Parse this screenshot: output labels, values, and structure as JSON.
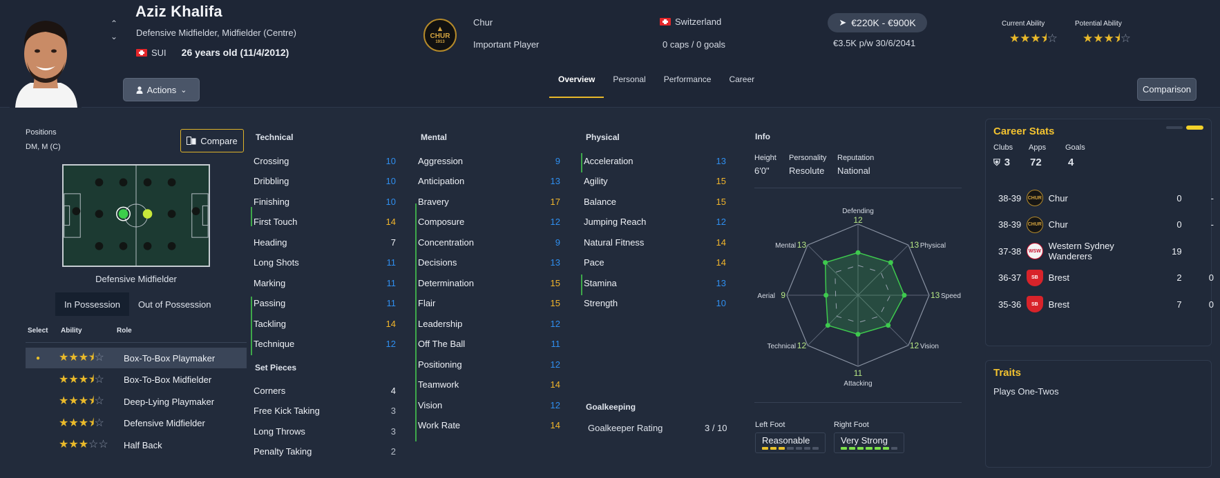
{
  "player": {
    "name": "Aziz Khalifa",
    "positions_full": "Defensive Midfielder, Midfielder (Centre)",
    "nationality_code": "SUI",
    "age_dob": "26 years old (11/4/2012)"
  },
  "header": {
    "actions_label": "Actions",
    "club": "Chur",
    "club_badge_text": "CHUR",
    "club_badge_year": "1913",
    "squad_status": "Important Player",
    "country": "Switzerland",
    "caps_goals": "0 caps / 0 goals",
    "value_range": "€220K - €900K",
    "wage_contract": "€3.5K p/w 30/6/2041",
    "current_ability_label": "Current Ability",
    "potential_ability_label": "Potential Ability",
    "current_ability_stars": 3.5,
    "potential_ability_stars": 3.5,
    "comparison_label": "Comparison"
  },
  "tabs": [
    "Overview",
    "Personal",
    "Performance",
    "Career"
  ],
  "active_tab": "Overview",
  "left": {
    "positions_label": "Positions",
    "positions_short": "DM, M (C)",
    "compare_label": "Compare",
    "pitch_caption": "Defensive Midfielder",
    "possession_tabs": [
      "In Possession",
      "Out of Possession"
    ],
    "role_headers": {
      "select": "Select",
      "ability": "Ability",
      "role": "Role"
    },
    "roles": [
      {
        "name": "Box-To-Box Playmaker",
        "stars": 3.5,
        "selected": true
      },
      {
        "name": "Box-To-Box Midfielder",
        "stars": 3.5,
        "selected": false
      },
      {
        "name": "Deep-Lying Playmaker",
        "stars": 3.5,
        "selected": false
      },
      {
        "name": "Defensive Midfielder",
        "stars": 3.5,
        "selected": false
      },
      {
        "name": "Half Back",
        "stars": 3,
        "selected": false
      }
    ]
  },
  "technical": {
    "title": "Technical",
    "attrs": [
      {
        "name": "Crossing",
        "value": "10",
        "color": "#2f8ff0"
      },
      {
        "name": "Dribbling",
        "value": "10",
        "color": "#2f8ff0"
      },
      {
        "name": "Finishing",
        "value": "10",
        "color": "#2f8ff0"
      },
      {
        "name": "First Touch",
        "value": "14",
        "color": "#f2b52b"
      },
      {
        "name": "Heading",
        "value": "7",
        "color": "#eef1f6"
      },
      {
        "name": "Long Shots",
        "value": "11",
        "color": "#2f8ff0"
      },
      {
        "name": "Marking",
        "value": "11",
        "color": "#2f8ff0"
      },
      {
        "name": "Passing",
        "value": "11",
        "color": "#2f8ff0"
      },
      {
        "name": "Tackling",
        "value": "14",
        "color": "#f2b52b"
      },
      {
        "name": "Technique",
        "value": "12",
        "color": "#2f8ff0"
      }
    ]
  },
  "set_pieces": {
    "title": "Set Pieces",
    "attrs": [
      {
        "name": "Corners",
        "value": "4",
        "color": "#eef1f6"
      },
      {
        "name": "Free Kick Taking",
        "value": "3",
        "color": "#b7bec9"
      },
      {
        "name": "Long Throws",
        "value": "3",
        "color": "#b7bec9"
      },
      {
        "name": "Penalty Taking",
        "value": "2",
        "color": "#b7bec9"
      }
    ]
  },
  "mental": {
    "title": "Mental",
    "attrs": [
      {
        "name": "Aggression",
        "value": "9",
        "color": "#2f8ff0"
      },
      {
        "name": "Anticipation",
        "value": "13",
        "color": "#2f8ff0"
      },
      {
        "name": "Bravery",
        "value": "17",
        "color": "#f2b52b"
      },
      {
        "name": "Composure",
        "value": "12",
        "color": "#2f8ff0"
      },
      {
        "name": "Concentration",
        "value": "9",
        "color": "#2f8ff0"
      },
      {
        "name": "Decisions",
        "value": "13",
        "color": "#2f8ff0"
      },
      {
        "name": "Determination",
        "value": "15",
        "color": "#f2b52b"
      },
      {
        "name": "Flair",
        "value": "15",
        "color": "#f2b52b"
      },
      {
        "name": "Leadership",
        "value": "12",
        "color": "#2f8ff0"
      },
      {
        "name": "Off The Ball",
        "value": "11",
        "color": "#2f8ff0"
      },
      {
        "name": "Positioning",
        "value": "12",
        "color": "#2f8ff0"
      },
      {
        "name": "Teamwork",
        "value": "14",
        "color": "#f2b52b"
      },
      {
        "name": "Vision",
        "value": "12",
        "color": "#2f8ff0"
      },
      {
        "name": "Work Rate",
        "value": "14",
        "color": "#f2b52b"
      }
    ]
  },
  "physical": {
    "title": "Physical",
    "attrs": [
      {
        "name": "Acceleration",
        "value": "13",
        "color": "#2f8ff0"
      },
      {
        "name": "Agility",
        "value": "15",
        "color": "#f2b52b"
      },
      {
        "name": "Balance",
        "value": "15",
        "color": "#f2b52b"
      },
      {
        "name": "Jumping Reach",
        "value": "12",
        "color": "#2f8ff0"
      },
      {
        "name": "Natural Fitness",
        "value": "14",
        "color": "#f2b52b"
      },
      {
        "name": "Pace",
        "value": "14",
        "color": "#f2b52b"
      },
      {
        "name": "Stamina",
        "value": "13",
        "color": "#2f8ff0"
      },
      {
        "name": "Strength",
        "value": "10",
        "color": "#2f8ff0"
      }
    ]
  },
  "goalkeeping": {
    "title": "Goalkeeping",
    "rating_label": "Goalkeeper Rating",
    "rating_value": "3 / 10"
  },
  "info": {
    "title": "Info",
    "height_label": "Height",
    "height": "6'0\"",
    "personality_label": "Personality",
    "personality": "Resolute",
    "reputation_label": "Reputation",
    "reputation": "National",
    "left_foot_label": "Left Foot",
    "left_foot": "Reasonable",
    "left_foot_level": 3,
    "right_foot_label": "Right Foot",
    "right_foot": "Very Strong",
    "right_foot_level": 6,
    "left_foot_color": "#e9c12a",
    "right_foot_color": "#7be04a"
  },
  "radar": {
    "axes": [
      {
        "label": "Defending",
        "value": "12"
      },
      {
        "label": "Physical",
        "value": "13"
      },
      {
        "label": "Speed",
        "value": "13"
      },
      {
        "label": "Vision",
        "value": "12"
      },
      {
        "label": "Attacking",
        "value": "11"
      },
      {
        "label": "Technical",
        "value": "12"
      },
      {
        "label": "Aerial",
        "value": "9"
      },
      {
        "label": "Mental",
        "value": "13"
      }
    ]
  },
  "career": {
    "title": "Career Stats",
    "clubs_label": "Clubs",
    "clubs": "3",
    "apps_label": "Apps",
    "apps": "72",
    "goals_label": "Goals",
    "goals": "4",
    "rows": [
      {
        "season": "38-39",
        "club": "Chur",
        "crest": "CHUR",
        "apps": "0",
        "goals": "-"
      },
      {
        "season": "38-39",
        "club": "Chur",
        "crest": "CHUR",
        "apps": "0",
        "goals": "-"
      },
      {
        "season": "37-38",
        "club": "Western Sydney Wanderers",
        "crest": "WSW",
        "apps": "19",
        "goals": ""
      },
      {
        "season": "36-37",
        "club": "Brest",
        "crest": "SB",
        "apps": "2",
        "goals": "0"
      },
      {
        "season": "35-36",
        "club": "Brest",
        "crest": "SB",
        "apps": "7",
        "goals": "0"
      }
    ]
  },
  "traits": {
    "title": "Traits",
    "items": [
      "Plays One-Twos"
    ]
  }
}
